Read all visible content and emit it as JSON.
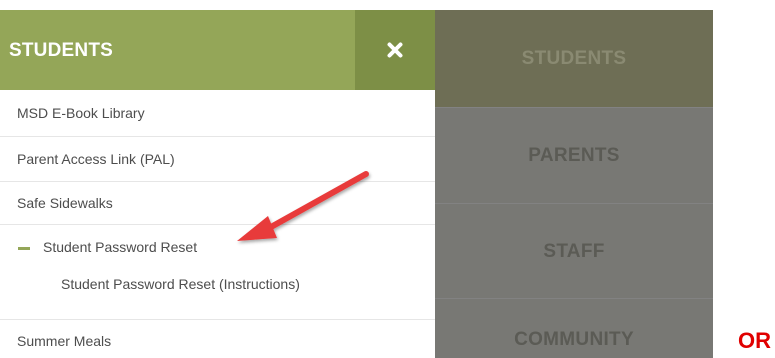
{
  "panel": {
    "title": "STUDENTS",
    "close_icon": "close-icon",
    "items": [
      {
        "label": "MSD E-Book Library"
      },
      {
        "label": "Parent Access Link (PAL)"
      },
      {
        "label": "Safe Sidewalks"
      },
      {
        "label": "Student Password Reset",
        "active": true
      },
      {
        "label": "Summer Meals"
      }
    ],
    "subitems": [
      {
        "label": "Student Password Reset (Instructions)"
      }
    ]
  },
  "right_nav": {
    "items": [
      {
        "label": "STUDENTS"
      },
      {
        "label": "PARENTS"
      },
      {
        "label": "STAFF"
      },
      {
        "label": "COMMUNITY"
      }
    ]
  },
  "annotation": {
    "or_text": "OR",
    "arrow_color": "#e83a3a"
  },
  "colors": {
    "accent": "#94a658",
    "accent_dark": "#7d8f46",
    "overlay": "#787874",
    "annotation_red": "#e00000"
  }
}
